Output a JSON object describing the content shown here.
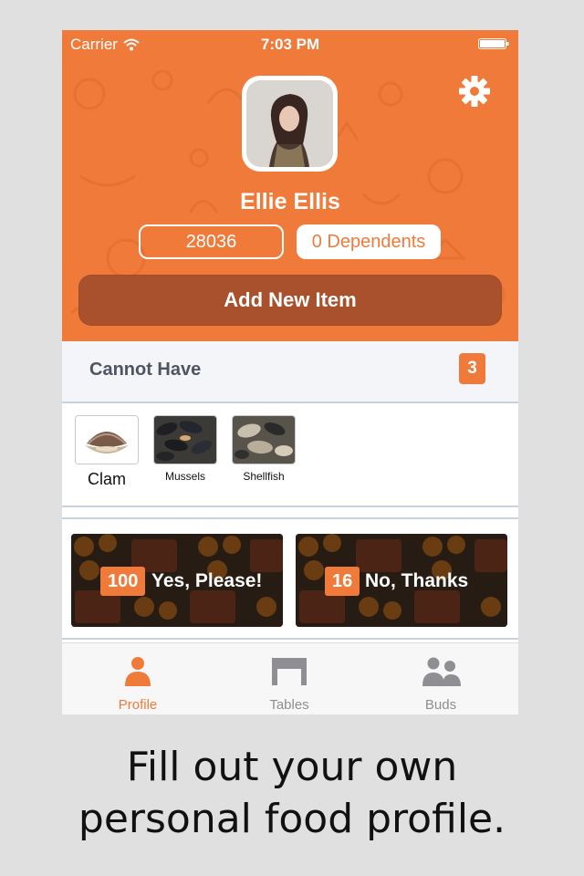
{
  "status": {
    "carrier": "Carrier",
    "time": "7:03 PM"
  },
  "profile": {
    "name": "Ellie Ellis",
    "zip": "28036",
    "dependents": "0 Dependents",
    "add_button": "Add New Item"
  },
  "cannot_have": {
    "title": "Cannot Have",
    "count": "3",
    "items": [
      {
        "label": "Clam",
        "icon": "clam-image"
      },
      {
        "label": "Mussels",
        "icon": "mussels-image"
      },
      {
        "label": "Shellfish",
        "icon": "shellfish-image"
      }
    ]
  },
  "cards": [
    {
      "count": "100",
      "label": "Yes, Please!"
    },
    {
      "count": "16",
      "label": "No, Thanks"
    }
  ],
  "tabs": [
    {
      "label": "Profile",
      "icon": "person-icon",
      "active": true
    },
    {
      "label": "Tables",
      "icon": "table-icon",
      "active": false
    },
    {
      "label": "Buds",
      "icon": "people-icon",
      "active": false
    }
  ],
  "caption": {
    "line1": "Fill out your own",
    "line2": "personal food profile."
  },
  "colors": {
    "accent": "#f07a3a",
    "button_dark": "#a8512c",
    "inactive_tab": "#8e8e93"
  }
}
